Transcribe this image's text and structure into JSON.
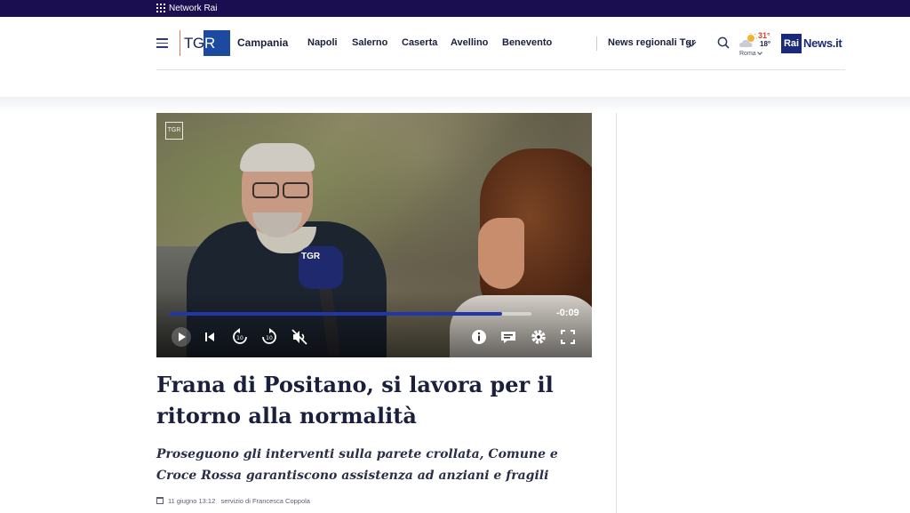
{
  "network_bar": {
    "label": "Network Rai"
  },
  "header": {
    "logo": "TGR",
    "region": "Campania",
    "nav": [
      "Napoli",
      "Salerno",
      "Caserta",
      "Avellino",
      "Benevento"
    ],
    "news_dropdown": "News regionali Tgr",
    "weather": {
      "high": "31°",
      "low": "18°",
      "city": "Roma"
    },
    "rainews": {
      "rai": "Rai",
      "news": "News.it"
    }
  },
  "video": {
    "corner_badge": "TGR",
    "mic_label": "TGR",
    "time_remaining": "-0:09",
    "progress": 0.92,
    "colors": {
      "progress_fill": "#2236a6"
    }
  },
  "article": {
    "headline": "Frana di Positano, si lavora per il ritorno alla normalità",
    "subtitle": "Proseguono gli interventi sulla parete crollata, Comune e Croce Rossa garantiscono assistenza ad anziani e fragili",
    "date": "11 giugno 13:12",
    "credit": "servizio di Francesca Coppola"
  },
  "colors": {
    "network_bar": "#1a0e50",
    "brand_blue": "#1d4aa1",
    "temp_high": "#d8412f"
  }
}
